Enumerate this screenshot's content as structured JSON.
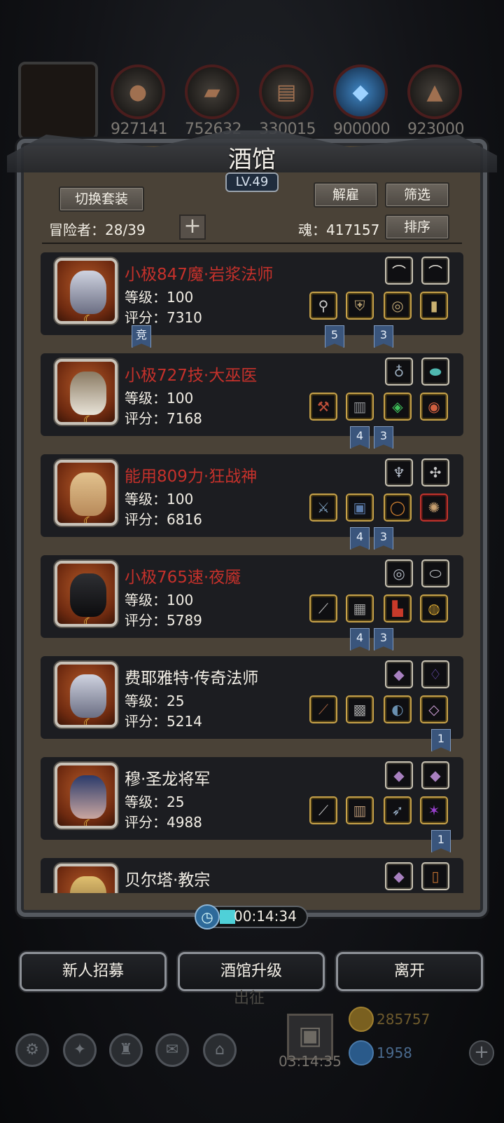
{
  "resources": {
    "items": [
      {
        "icon": "meat-icon",
        "value": "927141"
      },
      {
        "icon": "wood-icon",
        "value": "752632"
      },
      {
        "icon": "iron-icon",
        "value": "330015"
      },
      {
        "icon": "crystal-icon",
        "value": "900000"
      },
      {
        "icon": "stone-icon",
        "value": "923000"
      }
    ]
  },
  "panel": {
    "title": "酒馆",
    "level": "LV.49",
    "switch_set_label": "切换套装",
    "dismiss_label": "解雇",
    "filter_label": "筛选",
    "sort_label": "排序",
    "adventurers_label": "冒险者：28/39",
    "add_label": "+",
    "soul_label": "魂：417157"
  },
  "heroes": [
    {
      "name": "小极847魔·岩浆法师",
      "name_color": "red",
      "level": "等级：100",
      "score": "评分：7310",
      "flags": [
        "竞",
        "5",
        "3"
      ]
    },
    {
      "name": "小极727技·大巫医",
      "name_color": "red",
      "level": "等级：100",
      "score": "评分：7168",
      "flags": [
        "4",
        "3"
      ]
    },
    {
      "name": "能用809力·狂战神",
      "name_color": "red",
      "level": "等级：100",
      "score": "评分：6816",
      "flags": [
        "4",
        "3"
      ]
    },
    {
      "name": "小极765速·夜魇",
      "name_color": "red",
      "level": "等级：100",
      "score": "评分：5789",
      "flags": [
        "4",
        "3"
      ]
    },
    {
      "name": "费耶雅特·传奇法师",
      "name_color": "white",
      "level": "等级：25",
      "score": "评分：5214",
      "flags": [
        "1"
      ]
    },
    {
      "name": "穆·圣龙将军",
      "name_color": "white",
      "level": "等级：25",
      "score": "评分：4988",
      "flags": [
        "1"
      ]
    },
    {
      "name": "贝尔塔·教宗",
      "name_color": "white",
      "level": "",
      "score": "",
      "flags": []
    }
  ],
  "timer": {
    "value": "00:14:34"
  },
  "actions": {
    "recruit_label": "新人招募",
    "upgrade_label": "酒馆升级",
    "leave_label": "离开"
  },
  "hud": {
    "under_text": "出征",
    "gift_timer": "03:14:35",
    "gold": "285757",
    "gems": "1958"
  },
  "colors": {
    "name_red": "#c5312b",
    "panel_bg": "#4a4237",
    "flag_blue": "#3a557c"
  }
}
